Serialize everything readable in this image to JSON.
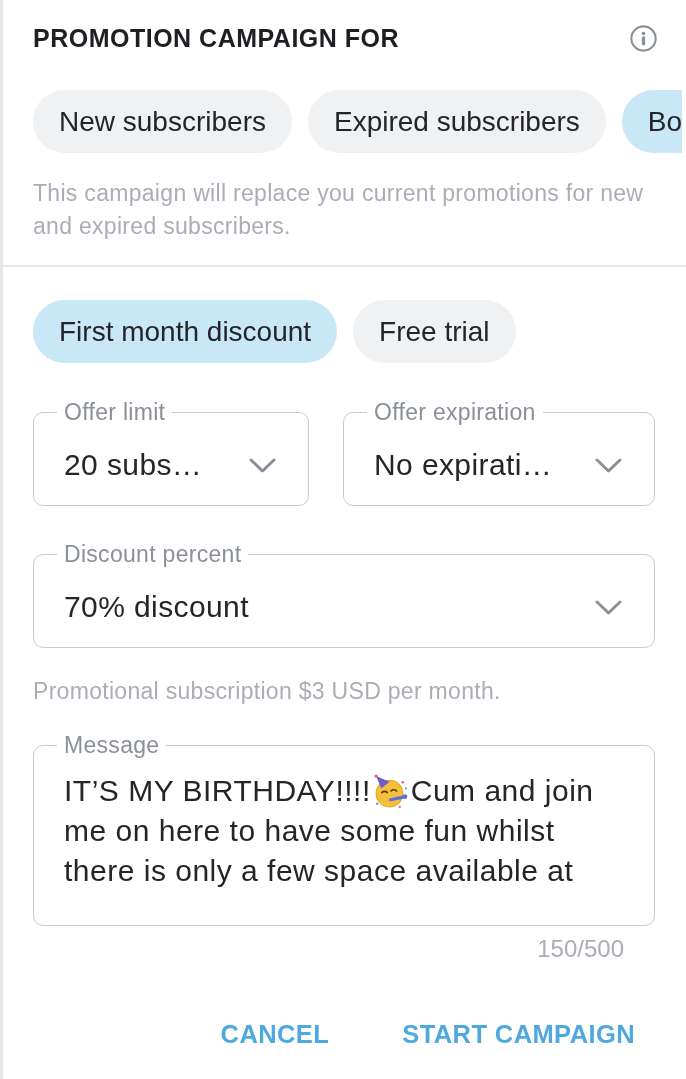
{
  "header": {
    "title": "PROMOTION CAMPAIGN FOR"
  },
  "audience_chips": [
    {
      "label": "New subscribers",
      "selected": false
    },
    {
      "label": "Expired subscribers",
      "selected": false
    },
    {
      "label": "Bo",
      "selected": true
    }
  ],
  "audience_note": "This campaign will replace you current promotions for new and expired subscribers.",
  "offer_type_chips": [
    {
      "label": "First month discount",
      "selected": true
    },
    {
      "label": "Free trial",
      "selected": false
    }
  ],
  "dropdown_rows": [
    [
      {
        "label": "Offer limit",
        "value": "20 subs…"
      },
      {
        "label": "Offer expiration",
        "value": "No expirati…"
      }
    ],
    [
      {
        "label": "Discount percent",
        "value": "70% discount"
      }
    ]
  ],
  "price_note": "Promotional subscription $3 USD per month.",
  "message": {
    "label": "Message",
    "lines": [
      [
        {
          "kind": "text",
          "text": "IT’S MY BIRTHDAY!!!!"
        },
        {
          "kind": "emoji"
        },
        {
          "kind": "text",
          "text": "Cum and join"
        }
      ],
      [
        {
          "kind": "text",
          "text": "me on here to have some fun whilst"
        }
      ],
      [
        {
          "kind": "text",
          "text": "there is only a few space available at"
        }
      ]
    ],
    "counter": "150/500"
  },
  "buttons": [
    {
      "label": "CANCEL"
    },
    {
      "label": "START CAMPAIGN"
    }
  ]
}
